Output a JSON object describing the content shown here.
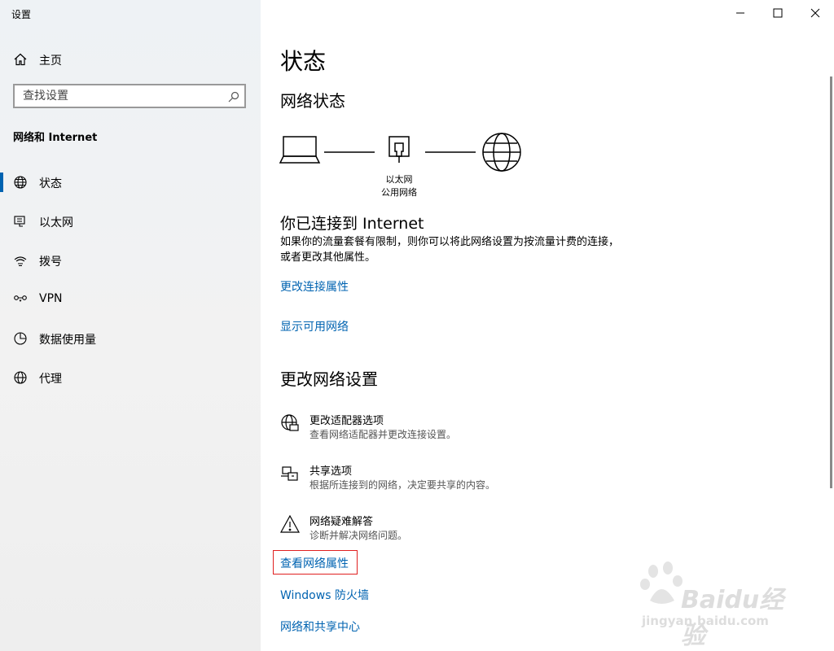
{
  "window": {
    "title": "设置"
  },
  "sidebar": {
    "home_label": "主页",
    "search_placeholder": "查找设置",
    "section_title": "网络和 Internet",
    "items": [
      {
        "label": "状态",
        "icon": "globe-icon",
        "active": true
      },
      {
        "label": "以太网",
        "icon": "ethernet-icon"
      },
      {
        "label": "拨号",
        "icon": "dialup-icon"
      },
      {
        "label": "VPN",
        "icon": "vpn-icon"
      },
      {
        "label": "数据使用量",
        "icon": "data-usage-icon"
      },
      {
        "label": "代理",
        "icon": "globe-icon"
      }
    ]
  },
  "main": {
    "page_title": "状态",
    "network_status_heading": "网络状态",
    "diagram": {
      "device_label": "以太网",
      "network_label": "公用网络"
    },
    "connected_title": "你已连接到 Internet",
    "connected_desc": "如果你的流量套餐有限制，则你可以将此网络设置为按流量计费的连接，或者更改其他属性。",
    "links_top": [
      {
        "label": "更改连接属性"
      },
      {
        "label": "显示可用网络"
      }
    ],
    "change_settings_heading": "更改网络设置",
    "settings": [
      {
        "title": "更改适配器选项",
        "subtitle": "查看网络适配器并更改连接设置。",
        "icon": "adapter-icon"
      },
      {
        "title": "共享选项",
        "subtitle": "根据所连接到的网络，决定要共享的内容。",
        "icon": "sharing-icon"
      },
      {
        "title": "网络疑难解答",
        "subtitle": "诊断并解决网络问题。",
        "icon": "warning-icon"
      }
    ],
    "links_bottom": [
      {
        "label": "查看网络属性"
      },
      {
        "label": "Windows 防火墙"
      },
      {
        "label": "网络和共享中心"
      }
    ]
  },
  "watermark": {
    "brand": "Baidu经验",
    "url": "jingyan.baidu.com"
  },
  "colors": {
    "accent": "#0063b1",
    "highlight_box": "#e02020"
  }
}
